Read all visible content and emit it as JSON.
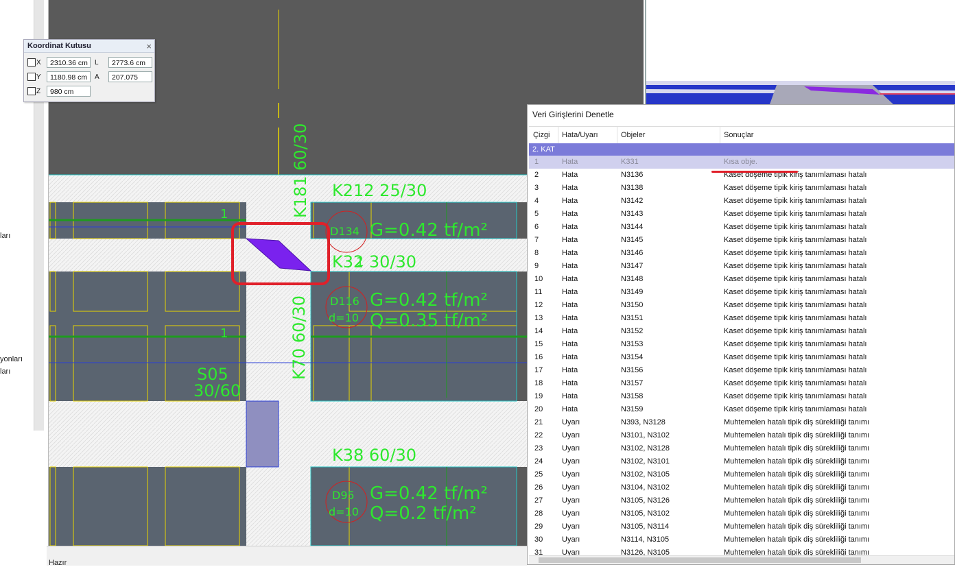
{
  "left_labels": [
    "ları",
    "yonları",
    "ları"
  ],
  "status": "Hazır",
  "coord_box": {
    "title": "Koordinat Kutusu",
    "x_label": "X",
    "x_value": "2310.36 cm",
    "y_label": "Y",
    "y_value": "1180.98 cm",
    "z_label": "Z",
    "z_value": "980 cm",
    "l_label": "L",
    "l_value": "2773.6 cm",
    "a_label": "A",
    "a_value": "207.075"
  },
  "cad_labels": {
    "k181": "K181 60/30",
    "k212": "K212 25/30",
    "k32": "K32 30/30",
    "k70": "K70 60/30",
    "k38": "K38 60/30",
    "s05_a": "S05",
    "s05_b": "30/60",
    "d134": "D134",
    "d134_g": "G=0.42 tf/m²",
    "d116": "D116",
    "d116_d": "d=10",
    "d116_g": "G=0.42 tf/m²",
    "d116_q": "Q=0.35 tf/m²",
    "d95": "D95",
    "d95_d": "d=10",
    "d95_g": "G=0.42 tf/m²",
    "d95_q": "Q=0.2 tf/m²",
    "axis_1a": "1",
    "axis_1b": "1",
    "axis_1c": "1"
  },
  "dialog": {
    "title": "Veri Girişlerini Denetle",
    "columns": [
      "Çizgi",
      "Hata/Uyarı",
      "Objeler",
      "Sonuçlar"
    ],
    "group": "2. KAT",
    "rows": [
      [
        "1",
        "Hata",
        "K331",
        "Kısa obje."
      ],
      [
        "2",
        "Hata",
        "N3136",
        "Kaset döşeme tipik kiriş tanımlaması hatalı"
      ],
      [
        "3",
        "Hata",
        "N3138",
        "Kaset döşeme tipik kiriş tanımlaması hatalı"
      ],
      [
        "4",
        "Hata",
        "N3142",
        "Kaset döşeme tipik kiriş tanımlaması hatalı"
      ],
      [
        "5",
        "Hata",
        "N3143",
        "Kaset döşeme tipik kiriş tanımlaması hatalı"
      ],
      [
        "6",
        "Hata",
        "N3144",
        "Kaset döşeme tipik kiriş tanımlaması hatalı"
      ],
      [
        "7",
        "Hata",
        "N3145",
        "Kaset döşeme tipik kiriş tanımlaması hatalı"
      ],
      [
        "8",
        "Hata",
        "N3146",
        "Kaset döşeme tipik kiriş tanımlaması hatalı"
      ],
      [
        "9",
        "Hata",
        "N3147",
        "Kaset döşeme tipik kiriş tanımlaması hatalı"
      ],
      [
        "10",
        "Hata",
        "N3148",
        "Kaset döşeme tipik kiriş tanımlaması hatalı"
      ],
      [
        "11",
        "Hata",
        "N3149",
        "Kaset döşeme tipik kiriş tanımlaması hatalı"
      ],
      [
        "12",
        "Hata",
        "N3150",
        "Kaset döşeme tipik kiriş tanımlaması hatalı"
      ],
      [
        "13",
        "Hata",
        "N3151",
        "Kaset döşeme tipik kiriş tanımlaması hatalı"
      ],
      [
        "14",
        "Hata",
        "N3152",
        "Kaset döşeme tipik kiriş tanımlaması hatalı"
      ],
      [
        "15",
        "Hata",
        "N3153",
        "Kaset döşeme tipik kiriş tanımlaması hatalı"
      ],
      [
        "16",
        "Hata",
        "N3154",
        "Kaset döşeme tipik kiriş tanımlaması hatalı"
      ],
      [
        "17",
        "Hata",
        "N3156",
        "Kaset döşeme tipik kiriş tanımlaması hatalı"
      ],
      [
        "18",
        "Hata",
        "N3157",
        "Kaset döşeme tipik kiriş tanımlaması hatalı"
      ],
      [
        "19",
        "Hata",
        "N3158",
        "Kaset döşeme tipik kiriş tanımlaması hatalı"
      ],
      [
        "20",
        "Hata",
        "N3159",
        "Kaset döşeme tipik kiriş tanımlaması hatalı"
      ],
      [
        "21",
        "Uyarı",
        "N393, N3128",
        "Muhtemelen hatalı tipik diş sürekliliği tanımı"
      ],
      [
        "22",
        "Uyarı",
        "N3101, N3102",
        "Muhtemelen hatalı tipik diş sürekliliği tanımı"
      ],
      [
        "23",
        "Uyarı",
        "N3102, N3128",
        "Muhtemelen hatalı tipik diş sürekliliği tanımı"
      ],
      [
        "24",
        "Uyarı",
        "N3102, N3101",
        "Muhtemelen hatalı tipik diş sürekliliği tanımı"
      ],
      [
        "25",
        "Uyarı",
        "N3102, N3105",
        "Muhtemelen hatalı tipik diş sürekliliği tanımı"
      ],
      [
        "26",
        "Uyarı",
        "N3104, N3102",
        "Muhtemelen hatalı tipik diş sürekliliği tanımı"
      ],
      [
        "27",
        "Uyarı",
        "N3105, N3126",
        "Muhtemelen hatalı tipik diş sürekliliği tanımı"
      ],
      [
        "28",
        "Uyarı",
        "N3105, N3102",
        "Muhtemelen hatalı tipik diş sürekliliği tanımı"
      ],
      [
        "29",
        "Uyarı",
        "N3105, N3114",
        "Muhtemelen hatalı tipik diş sürekliliği tanımı"
      ],
      [
        "30",
        "Uyarı",
        "N3114, N3105",
        "Muhtemelen hatalı tipik diş sürekliliği tanımı"
      ],
      [
        "31",
        "Uyarı",
        "N3126, N3105",
        "Muhtemelen hatalı tipik diş sürekliliği tanımı"
      ]
    ]
  },
  "colors": {
    "cad_background": "#5a5a5a",
    "label_green": "#2ee82e",
    "highlight_red": "#e0202a",
    "group_row": "#7b7bd9",
    "selected_beam": "#7a22ee"
  }
}
